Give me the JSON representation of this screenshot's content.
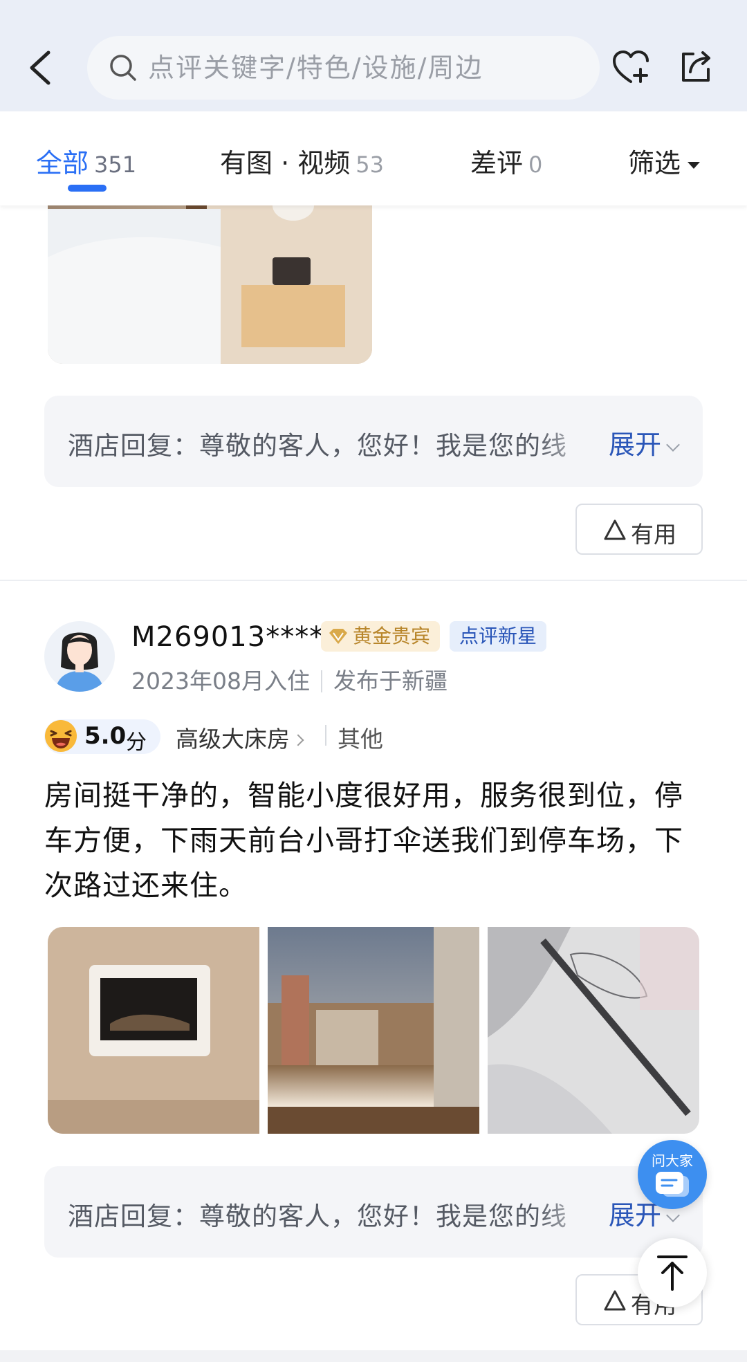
{
  "search": {
    "placeholder": "点评关键字/特色/设施/周边"
  },
  "tabs": [
    {
      "label": "全部",
      "count": "351"
    },
    {
      "label": "有图 · 视频",
      "count": "53"
    },
    {
      "label": "差评",
      "count": "0"
    },
    {
      "label": "筛选",
      "count": ""
    }
  ],
  "review1": {
    "reply": {
      "prefix": "酒店回复：",
      "text": "尊敬的客人，您好！我是您的线",
      "expand": "展开"
    },
    "useful": "有用"
  },
  "review2": {
    "username": "M269013****",
    "badges": {
      "level": "黄金贵宾",
      "tag": "点评新星"
    },
    "stay_date": "2023年08月入住",
    "published": "发布于新疆",
    "score": "5.0",
    "score_unit": "分",
    "room_type": "高级大床房",
    "trip_type": "其他",
    "text": "房间挺干净的，智能小度很好用，服务很到位，停车方便，下雨天前台小哥打伞送我们到停车场，下次路过还来住。",
    "reply": {
      "prefix": "酒店回复：",
      "text": "尊敬的客人，您好！我是您的线",
      "expand": "展开"
    },
    "useful": "有用"
  },
  "floating": {
    "ask": "问大家"
  },
  "colors": {
    "accent": "#2a6ff5",
    "header_bg": "#eaeef7",
    "gold_badge_bg": "#fbefd9",
    "star_badge_text": "#2a56b8"
  },
  "icons": [
    "back-icon",
    "search-icon",
    "heart-plus-icon",
    "share-icon",
    "triangle-icon",
    "diamond-icon",
    "smile-icon",
    "chat-icon",
    "back-to-top-icon"
  ]
}
